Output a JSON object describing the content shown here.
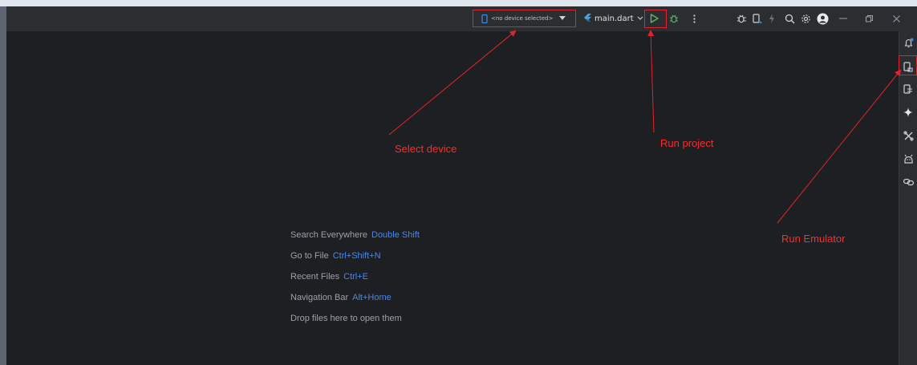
{
  "toolbar": {
    "device_selector": {
      "label": "<no device selected>",
      "icon": "phone-icon"
    },
    "run_config": {
      "label": "main.dart",
      "icon": "flutter-icon"
    },
    "window_controls": [
      "minimize",
      "restore",
      "close"
    ]
  },
  "annotations": {
    "select_device": "Select device",
    "run_project": "Run project",
    "run_emulator": "Run Emulator"
  },
  "hints": [
    {
      "text": "Search Everywhere",
      "key": "Double Shift"
    },
    {
      "text": "Go to File",
      "key": "Ctrl+Shift+N"
    },
    {
      "text": "Recent Files",
      "key": "Ctrl+E"
    },
    {
      "text": "Navigation Bar",
      "key": "Alt+Home"
    },
    {
      "text": "Drop files here to open them",
      "key": ""
    }
  ],
  "colors": {
    "annotation": "#ff2a2a",
    "shortcut_key": "#4a88e8",
    "run_green": "#5fb865",
    "background": "#1e1f22"
  }
}
